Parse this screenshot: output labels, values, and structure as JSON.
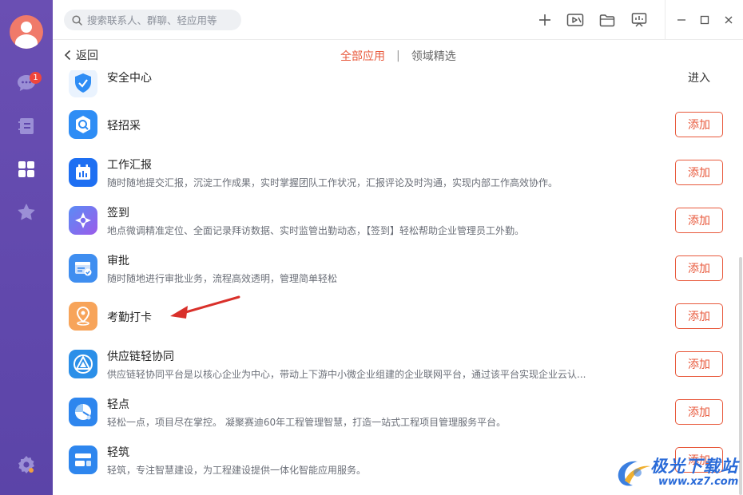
{
  "sidebar": {
    "items": [
      {
        "name": "messages",
        "icon": "chat-bubble-icon",
        "badge": "1"
      },
      {
        "name": "contacts",
        "icon": "address-book-icon"
      },
      {
        "name": "apps",
        "icon": "apps-grid-icon"
      },
      {
        "name": "favorites",
        "icon": "star-icon"
      }
    ],
    "settings_icon": "gear-icon"
  },
  "search": {
    "placeholder": "搜索联系人、群聊、轻应用等"
  },
  "toolbar": {
    "icons": [
      "plus-icon",
      "video-call-icon",
      "folder-icon",
      "screen-share-icon"
    ],
    "window": [
      "minimize-icon",
      "maximize-icon",
      "close-icon"
    ]
  },
  "nav": {
    "back_label": "返回",
    "tabs": [
      "全部应用",
      "领域精选"
    ],
    "separator": "|"
  },
  "apps": [
    {
      "name": "安全中心",
      "desc": "",
      "action": "进入",
      "icon": "shield-check-icon",
      "color": "#2e8df5"
    },
    {
      "name": "轻招采",
      "desc": "",
      "action": "添加",
      "icon": "search-badge-icon",
      "color": "#2e8df5"
    },
    {
      "name": "工作汇报",
      "desc": "随时随地提交汇报，沉淀工作成果，实时掌握团队工作状况，汇报评论及时沟通，实现内部工作高效协作。",
      "action": "添加",
      "icon": "calendar-report-icon",
      "color": "#1e6ff2"
    },
    {
      "name": "签到",
      "desc": "地点微调精准定位、全面记录拜访数据、实时监管出勤动态，【签到】轻松帮助企业管理员工外勤。",
      "action": "添加",
      "icon": "location-target-icon",
      "color": "#7a6cf0"
    },
    {
      "name": "审批",
      "desc": "随时随地进行审批业务，流程高效透明，管理简单轻松",
      "action": "添加",
      "icon": "approval-form-icon",
      "color": "#3f8ef0"
    },
    {
      "name": "考勤打卡",
      "desc": "",
      "action": "添加",
      "icon": "location-pin-icon",
      "color": "#f7a45a"
    },
    {
      "name": "供应链轻协同",
      "desc": "供应链轻协同平台是以核心企业为中心，带动上下游中小微企业组建的企业联网平台，通过该平台实现企业云认...",
      "action": "添加",
      "icon": "triangle-network-icon",
      "color": "#2b8fe8"
    },
    {
      "name": "轻点",
      "desc": "轻松一点，项目尽在掌控。 凝聚赛迪60年工程管理智慧，打造一站式工程项目管理服务平台。",
      "action": "添加",
      "icon": "pie-chart-icon",
      "color": "#2e86ee"
    },
    {
      "name": "轻筑",
      "desc": "轻筑，专注智慧建设，为工程建设提供一体化智能应用服务。",
      "action": "添加",
      "icon": "building-block-icon",
      "color": "#2e86ee"
    }
  ],
  "watermark": {
    "text": "极光下载站",
    "url": "www.xz7.com"
  },
  "colors": {
    "sidebar": "#5e46ab",
    "accent": "#e8593c",
    "badge": "#f0463c"
  }
}
